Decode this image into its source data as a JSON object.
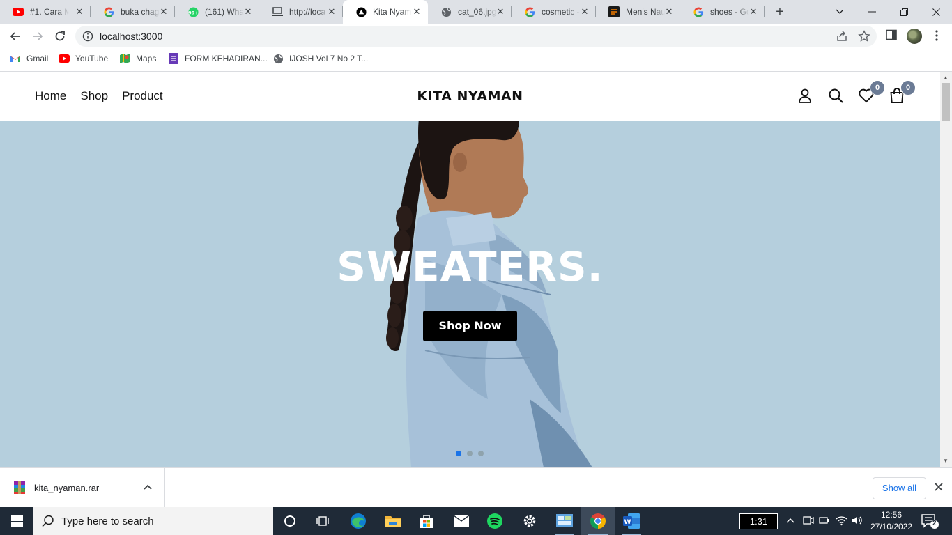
{
  "browser": {
    "tabs": [
      {
        "title": "#1. Cara M",
        "icon": "youtube-icon"
      },
      {
        "title": "buka chag",
        "icon": "google-icon"
      },
      {
        "title": "(161) What",
        "icon": "whatsapp-icon"
      },
      {
        "title": "http://loca",
        "icon": "laptop-icon"
      },
      {
        "title": "Kita Nyam",
        "icon": "nextjs-icon",
        "active": true
      },
      {
        "title": "cat_06.jpg",
        "icon": "globe-icon"
      },
      {
        "title": "cosmetic -",
        "icon": "google-icon"
      },
      {
        "title": "Men's Nau",
        "icon": "store-icon"
      },
      {
        "title": "shoes - Go",
        "icon": "google-icon"
      }
    ],
    "url": "localhost:3000",
    "bookmarks": [
      {
        "label": "Gmail",
        "icon": "gmail-icon"
      },
      {
        "label": "YouTube",
        "icon": "youtube-icon"
      },
      {
        "label": "Maps",
        "icon": "maps-icon"
      },
      {
        "label": "FORM KEHADIRAN...",
        "icon": "forms-icon"
      },
      {
        "label": "IJOSH Vol 7 No 2 T...",
        "icon": "globe-icon"
      }
    ]
  },
  "site": {
    "nav": [
      "Home",
      "Shop",
      "Product"
    ],
    "logo": "KITA NYAMAN",
    "wishlist_count": "0",
    "cart_count": "0",
    "hero": {
      "title": "SWEATERS.",
      "button": "Shop Now",
      "slides": 3,
      "active_slide": 1,
      "background": "#b5cfdd"
    }
  },
  "download": {
    "file": "kita_nyaman.rar",
    "show_all": "Show all"
  },
  "taskbar": {
    "search_placeholder": "Type here to search",
    "timer": "1:31",
    "time": "12:56",
    "date": "27/10/2022",
    "notifications": "2",
    "apps": [
      "task-view",
      "edge",
      "file-explorer",
      "store",
      "mail",
      "spotify",
      "settings",
      "control-panel",
      "chrome",
      "word"
    ]
  }
}
